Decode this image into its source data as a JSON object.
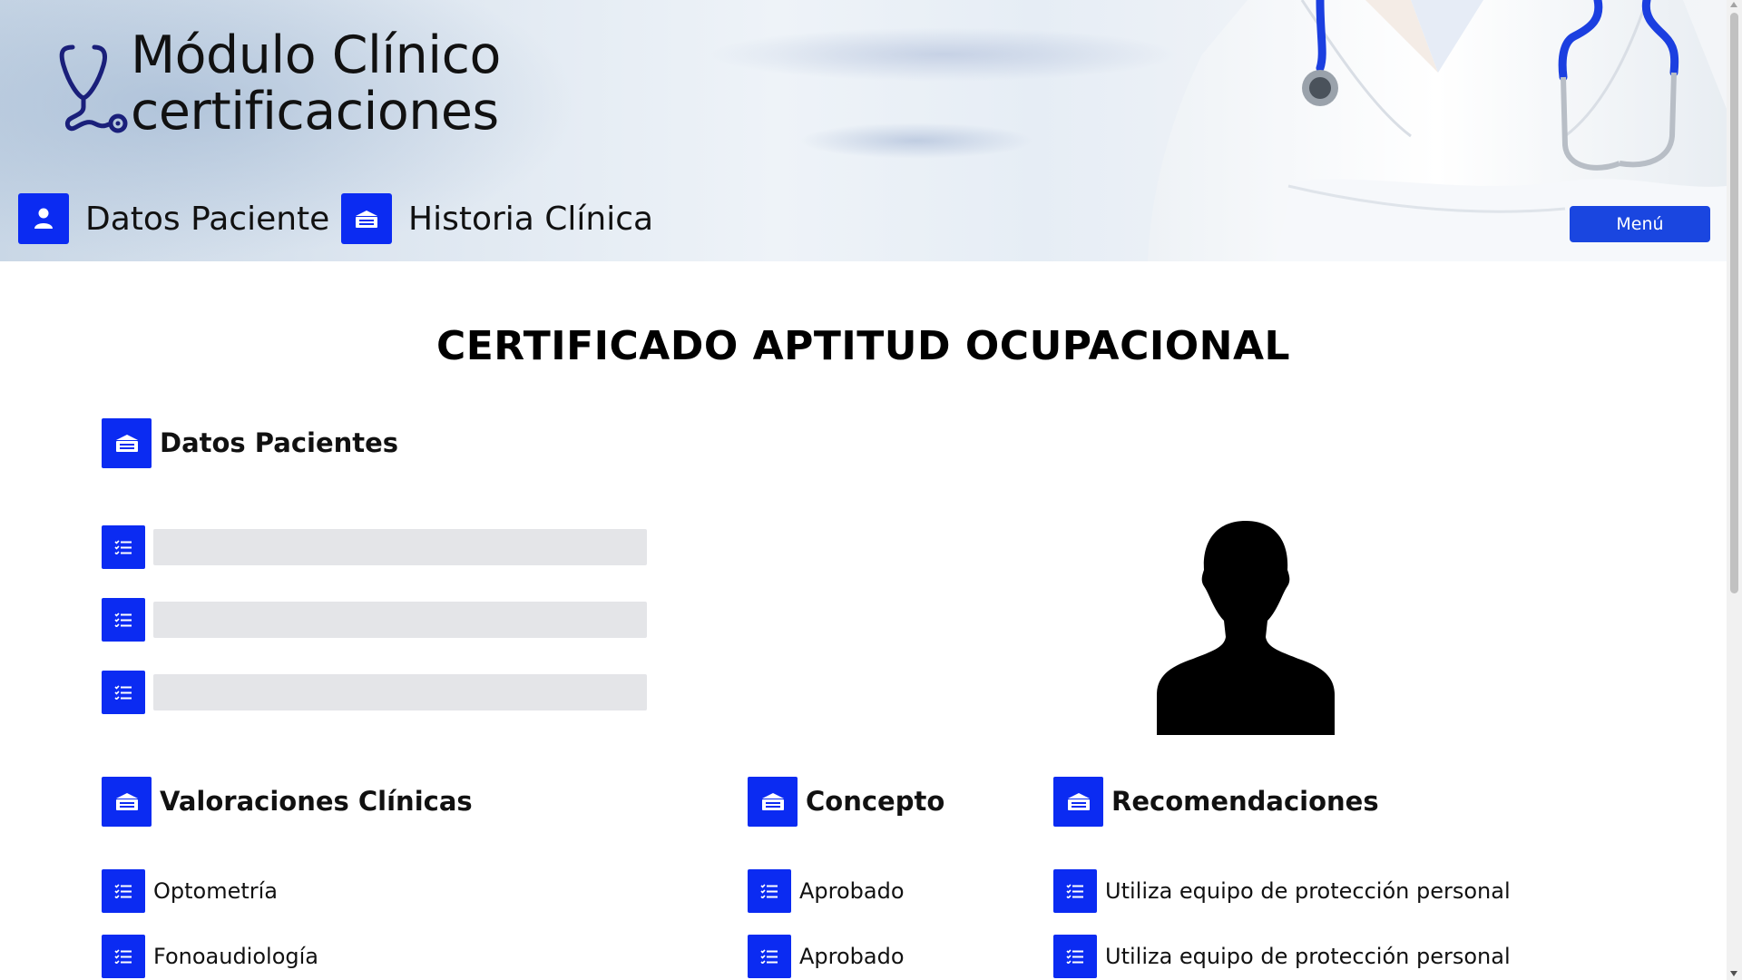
{
  "header": {
    "title_line1": "Módulo Clínico",
    "title_line2": "certificaciones",
    "nav": [
      {
        "label": "Datos Paciente",
        "icon": "user-icon"
      },
      {
        "label": "Historia Clínica",
        "icon": "id-card-icon"
      }
    ],
    "menu_label": "Menú"
  },
  "main": {
    "title": "CERTIFICADO APTITUD OCUPACIONAL",
    "datos_pacientes": {
      "heading": "Datos Pacientes",
      "fields": [
        {
          "value": "",
          "icon": "checklist-icon"
        },
        {
          "value": "",
          "icon": "checklist-icon"
        },
        {
          "value": "",
          "icon": "checklist-icon"
        }
      ]
    },
    "valoraciones": {
      "heading": "Valoraciones Clínicas",
      "items": [
        "Optometría",
        "Fonoaudiología"
      ]
    },
    "concepto": {
      "heading": "Concepto",
      "items": [
        "Aprobado",
        "Aprobado"
      ]
    },
    "recomendaciones": {
      "heading": "Recomendaciones",
      "items": [
        "Utiliza equipo de protección personal",
        "Utiliza equipo de protección personal"
      ]
    }
  },
  "colors": {
    "accent": "#0b2bf2",
    "menu_button": "#1a46e0",
    "input_bg": "#e4e5e8"
  }
}
